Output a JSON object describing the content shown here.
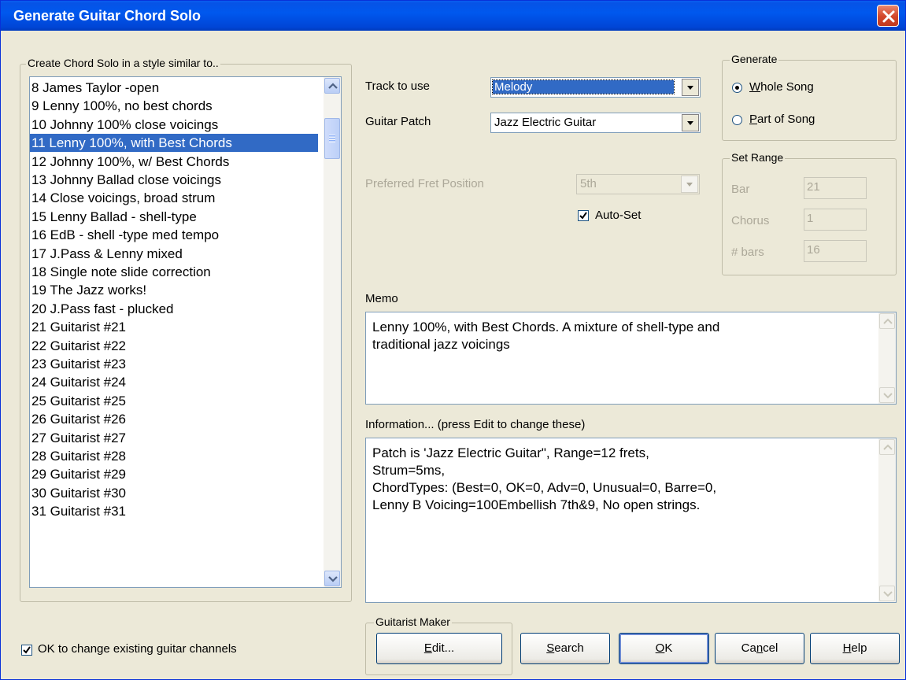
{
  "window": {
    "title": "Generate Guitar Chord Solo"
  },
  "styles_group": {
    "label": "Create Chord Solo in a style similar to..",
    "items": [
      "8 James Taylor -open",
      "9 Lenny 100%, no best chords",
      "10 Johnny 100% close voicings",
      "11 Lenny 100%, with Best Chords",
      "12 Johnny 100%, w/ Best Chords",
      "13 Johnny Ballad close voicings",
      "14 Close voicings, broad strum",
      "15 Lenny Ballad - shell-type",
      "16 EdB - shell -type med tempo",
      "17 J.Pass & Lenny mixed",
      "18 Single note slide correction",
      "19 The Jazz works!",
      "20 J.Pass fast - plucked",
      "21 Guitarist #21",
      "22 Guitarist #22",
      "23 Guitarist #23",
      "24 Guitarist #24",
      "25 Guitarist #25",
      "26 Guitarist #26",
      "27 Guitarist #27",
      "28 Guitarist #28",
      "29 Guitarist #29",
      "30 Guitarist #30",
      "31 Guitarist #31"
    ],
    "selected": "11 Lenny 100%, with Best Chords"
  },
  "ok_change_checkbox": {
    "label": "OK to change existing guitar channels",
    "checked": true
  },
  "track": {
    "label": "Track to use",
    "value": "Melody"
  },
  "patch": {
    "label": "Guitar Patch",
    "value": "Jazz Electric Guitar"
  },
  "fret": {
    "label": "Preferred Fret Position",
    "value": "5th"
  },
  "autoset": {
    "label": "Auto-Set",
    "checked": true
  },
  "generate": {
    "label": "Generate",
    "whole_prefix": "W",
    "whole_rest": "hole Song",
    "part_prefix": "P",
    "part_rest": "art of Song",
    "selected": "Whole Song"
  },
  "range": {
    "label": "Set Range",
    "bar_label": "Bar",
    "bar_value": "21",
    "chorus_label": "Chorus",
    "chorus_value": "1",
    "bars_label": "# bars",
    "bars_value": "16"
  },
  "memo": {
    "label": "Memo",
    "line1": "Lenny 100%, with Best Chords. A mixture of shell-type and",
    "line2": "traditional jazz voicings"
  },
  "info": {
    "label": "Information... (press Edit to change these)",
    "line1": "Patch is 'Jazz Electric Guitar\", Range=12 frets,",
    "line2": "Strum=5ms,",
    "line3": "ChordTypes: (Best=0, OK=0, Adv=0, Unusual=0, Barre=0,",
    "line4": "Lenny B Voicing=100Embellish 7th&9, No open strings."
  },
  "guitarist_maker": {
    "label": "Guitarist Maker"
  },
  "buttons": {
    "edit_u": "E",
    "edit_rest": "dit...",
    "search_u": "S",
    "search_rest": "earch",
    "ok_u": "O",
    "ok_rest": "K",
    "cancel_pre": "Ca",
    "cancel_u": "n",
    "cancel_rest": "cel",
    "help_u": "H",
    "help_rest": "elp"
  }
}
